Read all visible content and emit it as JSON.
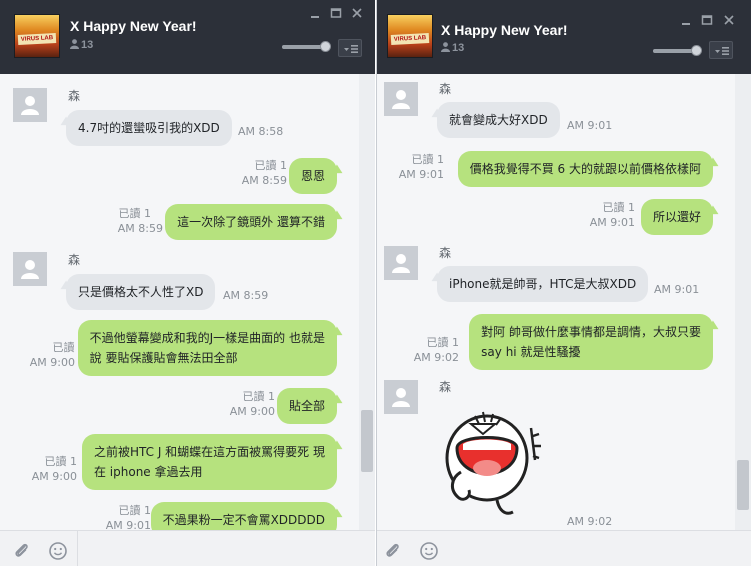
{
  "colors": {
    "titlebar": "#2c3039",
    "chat_bg": "#f5f6f8",
    "bubble_in": "#e3e6ea",
    "bubble_out": "#b6e27e"
  },
  "left": {
    "title": "X Happy New Year!",
    "member_count": "13",
    "avatar_text": "VIRUS LAB",
    "messages": [
      {
        "sender": "森",
        "text": "4.7吋的還蠻吸引我的XDD",
        "time": "AM 8:58"
      },
      {
        "read": "已讀 1",
        "time": "AM 8:59",
        "text": "恩恩"
      },
      {
        "read": "已讀 1",
        "time": "AM 8:59",
        "text": "這一次除了鏡頭外 還算不錯"
      },
      {
        "sender": "森",
        "text": "只是價格太不人性了XD",
        "time": "AM 8:59"
      },
      {
        "read": "已讀 1",
        "time": "AM 9:00",
        "line1": "不過他螢幕變成和我的J一樣是曲面的 也就是",
        "line2": "說 要貼保護貼會無法田全部"
      },
      {
        "read": "已讀 1",
        "time": "AM 9:00",
        "text": "貼全部"
      },
      {
        "read": "已讀 1",
        "time": "AM 9:00",
        "line1": "之前被HTC J 和蝴蝶在這方面被罵得要死 現",
        "line2": "在 iphone 拿過去用"
      },
      {
        "read": "已讀 1",
        "time": "AM 9:01",
        "text": "不過果粉一定不會罵XDDDDD"
      }
    ]
  },
  "right": {
    "title": "X Happy New Year!",
    "member_count": "13",
    "avatar_text": "VIRUS LAB",
    "messages": [
      {
        "sender": "森",
        "text": "就會變成大好XDD",
        "time": "AM 9:01"
      },
      {
        "read": "已讀 1",
        "time": "AM 9:01",
        "text": "價格我覺得不買 6   大的就跟以前價格依樣阿"
      },
      {
        "read": "已讀 1",
        "time": "AM 9:01",
        "text": "所以還好"
      },
      {
        "sender": "森",
        "text": "iPhone就是帥哥，HTC是大叔XDD",
        "time": "AM 9:01"
      },
      {
        "read": "已讀 1",
        "time": "AM 9:02",
        "line1": "對阿 帥哥做什麼事情都是調情，大叔只要",
        "line2": "say hi 就是性騷擾"
      },
      {
        "sender": "森",
        "time": "AM 9:02"
      }
    ]
  }
}
